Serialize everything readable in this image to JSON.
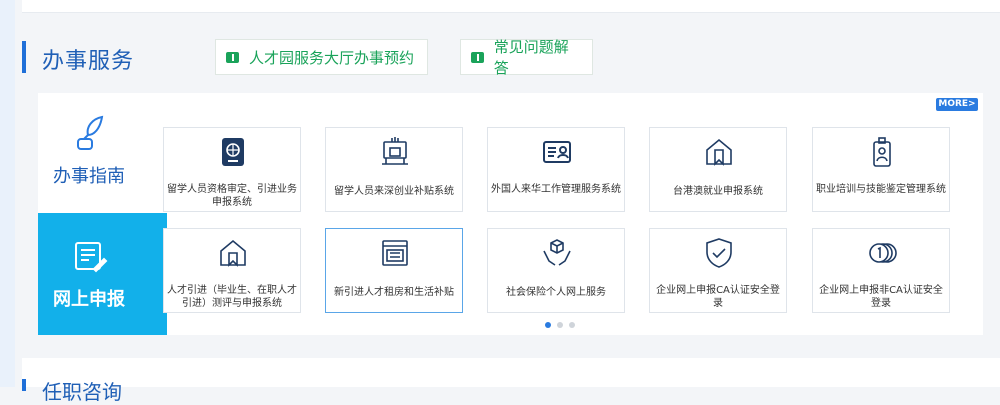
{
  "section": {
    "title": "办事服务"
  },
  "quick_links": [
    {
      "label": "人才园服务大厅办事预约"
    },
    {
      "label": "常见问题解答"
    }
  ],
  "more_label": "MORE>",
  "side": {
    "guide_label": "办事指南",
    "online_label": "网上申报"
  },
  "cards": [
    {
      "icon": "passport-globe-icon",
      "label": "留学人员资格审定、引进业务申报系统"
    },
    {
      "icon": "monitor-podium-icon",
      "label": "留学人员来深创业补贴系统"
    },
    {
      "icon": "id-card-icon",
      "label": "外国人来华工作管理服务系统"
    },
    {
      "icon": "bookmark-house-icon",
      "label": "台港澳就业申报系统"
    },
    {
      "icon": "badge-person-icon",
      "label": "职业培训与技能鉴定管理系统"
    },
    {
      "icon": "house-bookmark-icon",
      "label": "人才引进（毕业生、在职人才引进）测评与申报系统"
    },
    {
      "icon": "browser-window-icon",
      "label": "新引进人才租房和生活补贴"
    },
    {
      "icon": "hands-box-icon",
      "label": "社会保险个人网上服务"
    },
    {
      "icon": "shield-check-icon",
      "label": "企业网上申报CA认证安全登录"
    },
    {
      "icon": "coins-one-icon",
      "label": "企业网上申报非CA认证安全登录"
    }
  ],
  "pager": {
    "total": 3,
    "active": 1
  },
  "next_section": {
    "title": "任职咨询"
  },
  "colors": {
    "accent": "#1f5fb6",
    "green": "#1aa35a",
    "cyan": "#12b0ea"
  }
}
